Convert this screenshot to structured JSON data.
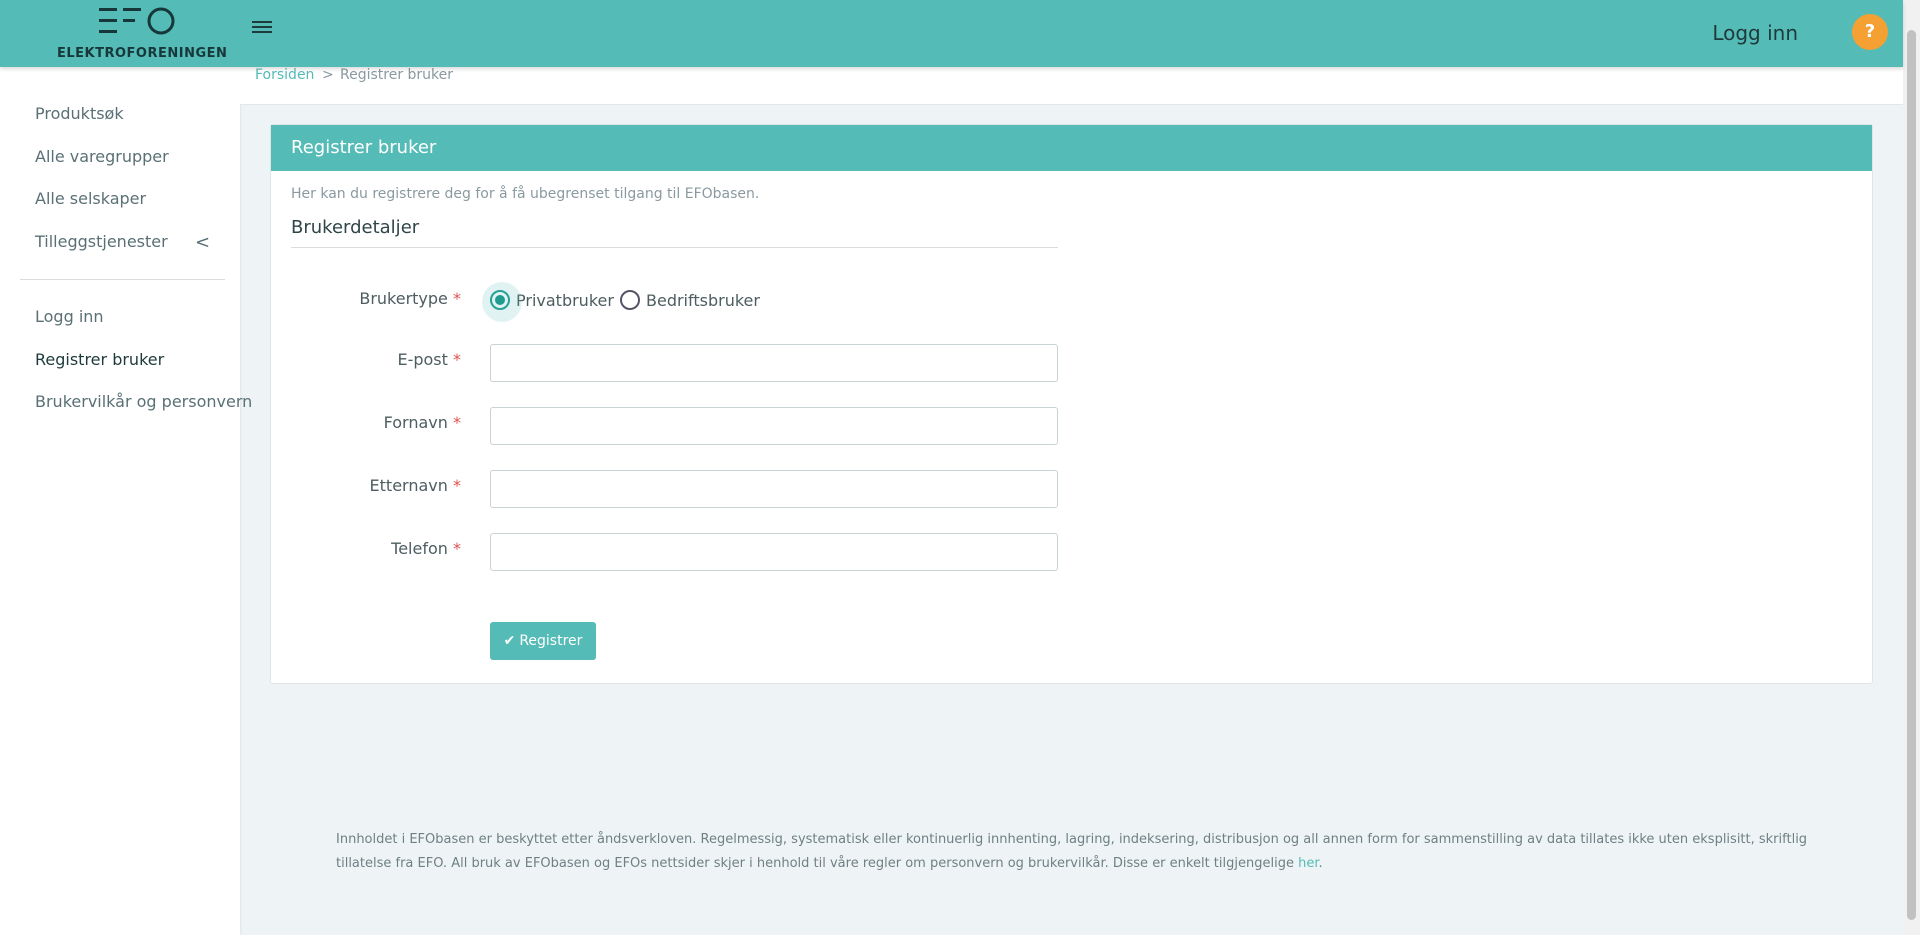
{
  "header": {
    "logo_text": "ELEKTROFORENINGEN",
    "login_label": "Logg inn",
    "help_label": "?"
  },
  "sidebar": {
    "items": [
      {
        "label": "Produktsøk"
      },
      {
        "label": "Alle varegrupper"
      },
      {
        "label": "Alle selskaper"
      },
      {
        "label": "Tilleggstjenester"
      },
      {
        "label": "Logg inn"
      },
      {
        "label": "Registrer bruker"
      },
      {
        "label": "Brukervilkår og personvern"
      }
    ],
    "chevron": "<"
  },
  "breadcrumb": {
    "home": "Forsiden",
    "separator": ">",
    "current": "Registrer bruker"
  },
  "card": {
    "title": "Registrer bruker",
    "intro": "Her kan du registrere deg for å få ubegrenset tilgang til EFObasen.",
    "section_title": "Brukerdetaljer"
  },
  "form": {
    "user_type_label": "Brukertype",
    "required_mark": "*",
    "radio_private": "Privatbruker",
    "radio_business": "Bedriftsbruker",
    "selected": "Privatbruker",
    "email_label": "E-post",
    "email_value": "",
    "firstname_label": "Fornavn",
    "firstname_value": "",
    "lastname_label": "Etternavn",
    "lastname_value": "",
    "phone_label": "Telefon",
    "phone_value": "",
    "submit_label": "Registrer",
    "submit_icon": "✔"
  },
  "footer": {
    "text": "Innholdet i EFObasen er beskyttet etter åndsverkloven. Regelmessig, systematisk eller kontinuerlig innhenting, lagring, indeksering, distribusjon og all annen form for sammenstilling av data tillates ikke uten eksplisitt, skriftlig tillatelse fra EFO. All bruk av EFObasen og EFOs nettsider skjer i henhold til våre regler om personvern og brukervilkår. Disse er enkelt tilgjengelige ",
    "link": "her",
    "end": "."
  },
  "colors": {
    "accent": "#54bbb6",
    "help": "#f5a032",
    "radio": "#1e9a8f"
  }
}
